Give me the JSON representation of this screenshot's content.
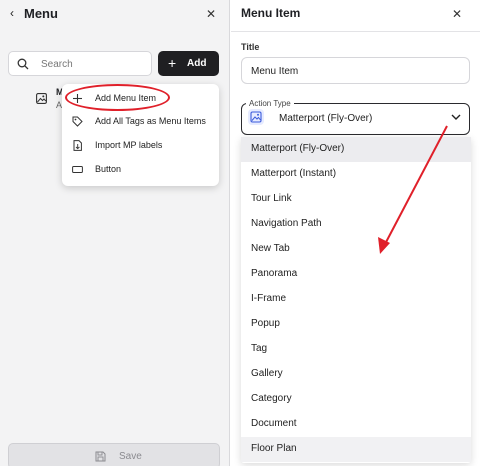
{
  "left_panel": {
    "title": "Menu",
    "back_icon": "chevron-left-icon",
    "close_icon": "close-icon",
    "search": {
      "placeholder": "Search",
      "value": ""
    },
    "add_button": {
      "label": "Add"
    },
    "list_item": {
      "name_initial": "M",
      "subtitle_initial": "A"
    },
    "dropdown": [
      {
        "label": "Add Menu Item",
        "icon": "plus-icon"
      },
      {
        "label": "Add All Tags as Menu Items",
        "icon": "tag-icon"
      },
      {
        "label": "Import MP labels",
        "icon": "file-import-icon"
      },
      {
        "label": "Button",
        "icon": "button-icon"
      }
    ],
    "save_button": {
      "label": "Save"
    }
  },
  "right_panel": {
    "title": "Menu Item",
    "close_icon": "close-icon",
    "title_field": {
      "label": "Title",
      "value": "Menu Item"
    },
    "action_type": {
      "legend": "Action Type",
      "value": "Matterport (Fly-Over)",
      "options": [
        "Matterport (Fly-Over)",
        "Matterport (Instant)",
        "Tour Link",
        "Navigation Path",
        "New Tab",
        "Panorama",
        "I-Frame",
        "Popup",
        "Tag",
        "Gallery",
        "Category",
        "Document",
        "Floor Plan"
      ]
    }
  },
  "annotation_color": "#e0202a"
}
